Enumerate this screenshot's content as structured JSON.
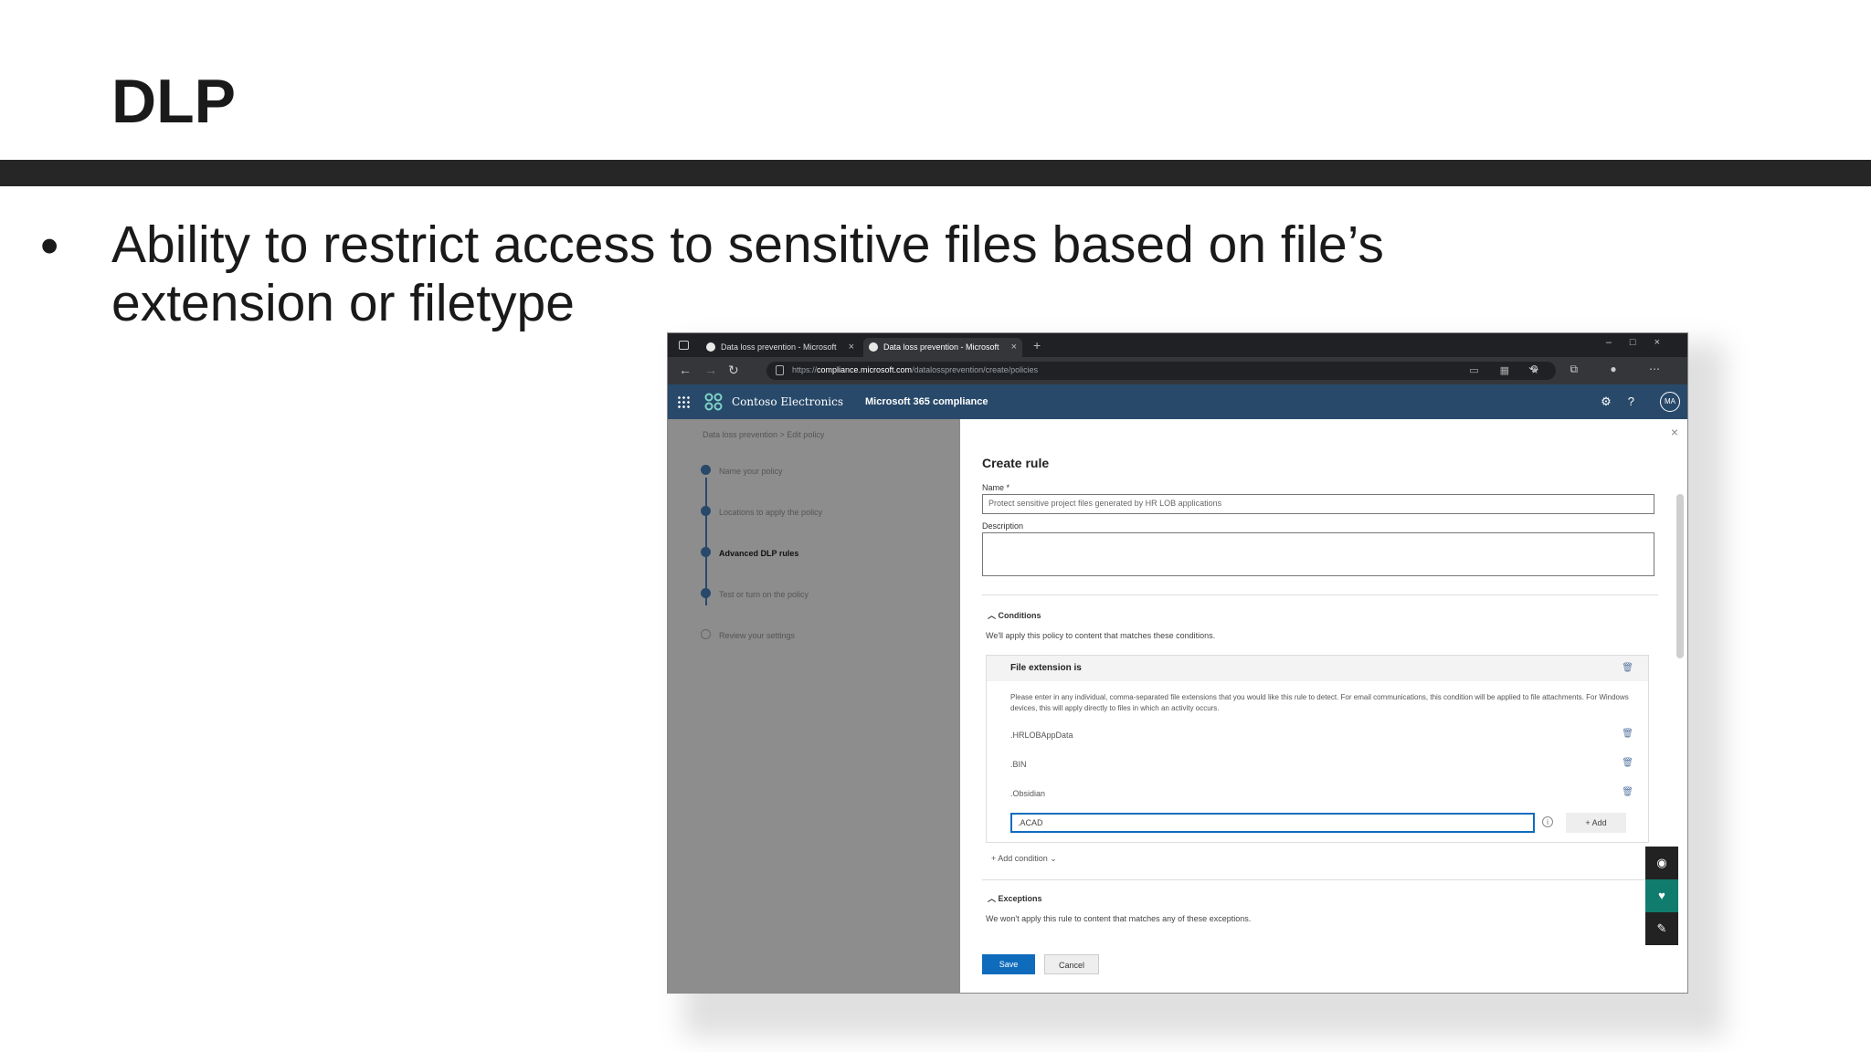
{
  "slide": {
    "title": "DLP",
    "bullet": "•",
    "bullet_text": "Ability to restrict access to sensitive files based on file’s extension or filetype"
  },
  "browser": {
    "tabs": [
      {
        "label": "Data loss prevention - Microsoft",
        "close": "×"
      },
      {
        "label": "Data loss prevention - Microsoft",
        "close": "×"
      }
    ],
    "new_tab": "+",
    "window_controls": "–□×",
    "url_prefix": "https://",
    "url_host": "compliance.microsoft.com",
    "url_path": "/datalossprevention/create/policies"
  },
  "app": {
    "brand": "Contoso Electronics",
    "product": "Microsoft 365 compliance",
    "header_icons": "⚙?",
    "avatar": "MA"
  },
  "wizard": {
    "breadcrumb": "Data loss prevention  >  Edit policy",
    "steps": [
      {
        "label": "Name your policy",
        "state": "done"
      },
      {
        "label": "Locations to apply the policy",
        "state": "done"
      },
      {
        "label": "Advanced DLP rules",
        "state": "current"
      },
      {
        "label": "Test or turn on the policy",
        "state": "todo"
      },
      {
        "label": "Review your settings",
        "state": "todo"
      }
    ]
  },
  "rule": {
    "close": "×",
    "title": "Create rule",
    "name_label": "Name *",
    "name_value": "Protect sensitive project files generated by HR LOB applications",
    "description_label": "Description",
    "description_value": "",
    "conditions_label": "Conditions",
    "conditions_hint": "We'll apply this policy to content that matches these conditions.",
    "condition_title": "File extension is",
    "condition_desc": "Please enter in any individual, comma-separated file extensions that you would like this rule to detect. For email communications, this condition will be applied to file attachments. For Windows devices, this will apply directly to files in which an activity occurs.",
    "extensions": [
      ".HRLOBAppData",
      ".BIN",
      ".Obsidian"
    ],
    "new_extension": ".ACAD",
    "info": "i",
    "add_label": "+  Add",
    "add_condition": "+  Add condition  ⌄",
    "exceptions_label": "Exceptions",
    "exceptions_hint": "We won't apply this rule to content that matches any of these exceptions.",
    "save_label": "Save",
    "cancel_label": "Cancel",
    "trash_icon": "🗑",
    "chevron": "︿",
    "fab_icons": [
      "◉",
      "♥",
      "✎"
    ]
  },
  "colors": {
    "app_header": "#28496a",
    "primary": "#0f6cbd",
    "slide_bar": "#262626",
    "overlay": "#8d8d8d"
  }
}
